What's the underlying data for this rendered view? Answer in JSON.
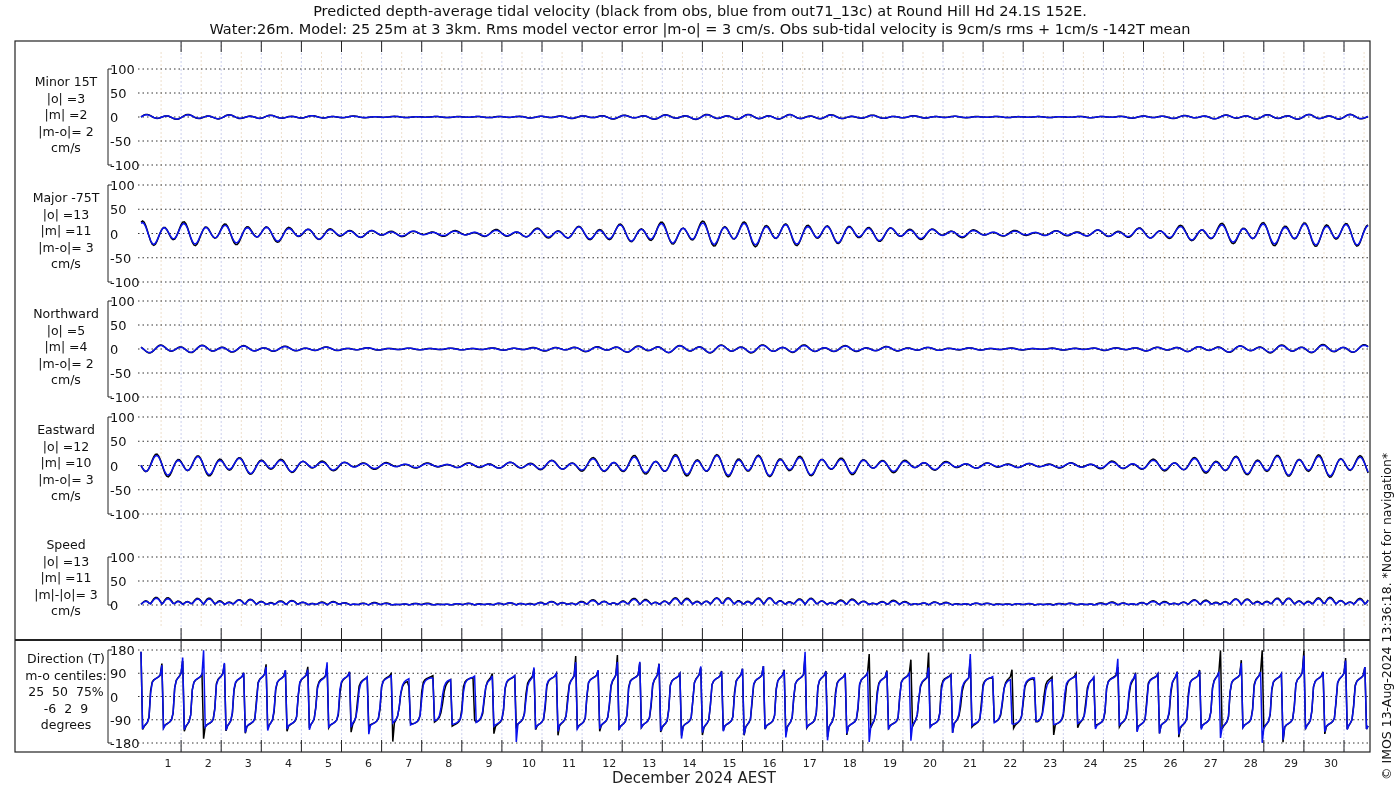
{
  "title": [
    "Predicted depth-average tidal velocity (black from obs, blue from out71_13c) at Round Hill Hd 24.1S 152E.",
    "Water:26m. Model: 25 25m at 3 3km. Rms model vector error |m-o| = 3 cm/s. Obs sub-tidal velocity is 9cm/s rms + 1cm/s -142T mean"
  ],
  "panels": [
    {
      "kind": "velocity",
      "label": [
        "Minor 15T",
        "|o| =3",
        "|m| =2",
        "|m-o|= 2",
        "cm/s"
      ],
      "yticks": [
        "100",
        "50",
        "0",
        "-50",
        "-100"
      ]
    },
    {
      "kind": "velocity",
      "label": [
        "Major -75T",
        "|o| =13",
        "|m| =11",
        "|m-o|= 3",
        "cm/s"
      ],
      "yticks": [
        "100",
        "50",
        "0",
        "-50",
        "-100"
      ]
    },
    {
      "kind": "velocity",
      "label": [
        "Northward",
        "|o| =5",
        "|m| =4",
        "|m-o|= 2",
        "cm/s"
      ],
      "yticks": [
        "100",
        "50",
        "0",
        "-50",
        "-100"
      ]
    },
    {
      "kind": "velocity",
      "label": [
        "Eastward",
        "|o| =12",
        "|m| =10",
        "|m-o|= 3",
        "cm/s"
      ],
      "yticks": [
        "100",
        "50",
        "0",
        "-50",
        "-100"
      ]
    },
    {
      "kind": "speed",
      "label": [
        "Speed",
        "|o| =13",
        "|m| =11",
        "|m|-|o|= 3",
        "cm/s"
      ],
      "yticks": [
        "100",
        "50",
        "0"
      ]
    },
    {
      "kind": "direction",
      "label": [
        "Direction (T)",
        "m-o centiles:",
        "25  50  75%",
        "-6  2  9",
        "degrees"
      ],
      "yticks": [
        "180",
        "90",
        "0",
        "-90",
        "-180"
      ]
    }
  ],
  "days": [
    "1",
    "2",
    "3",
    "4",
    "5",
    "6",
    "7",
    "8",
    "9",
    "10",
    "11",
    "12",
    "13",
    "14",
    "15",
    "16",
    "17",
    "18",
    "19",
    "20",
    "21",
    "22",
    "23",
    "24",
    "25",
    "26",
    "27",
    "28",
    "29",
    "30"
  ],
  "xlabel": "December 2024 AEST",
  "copyright": "© IMOS 13-Aug-2024 13:36:18. *Not for navigation*"
}
